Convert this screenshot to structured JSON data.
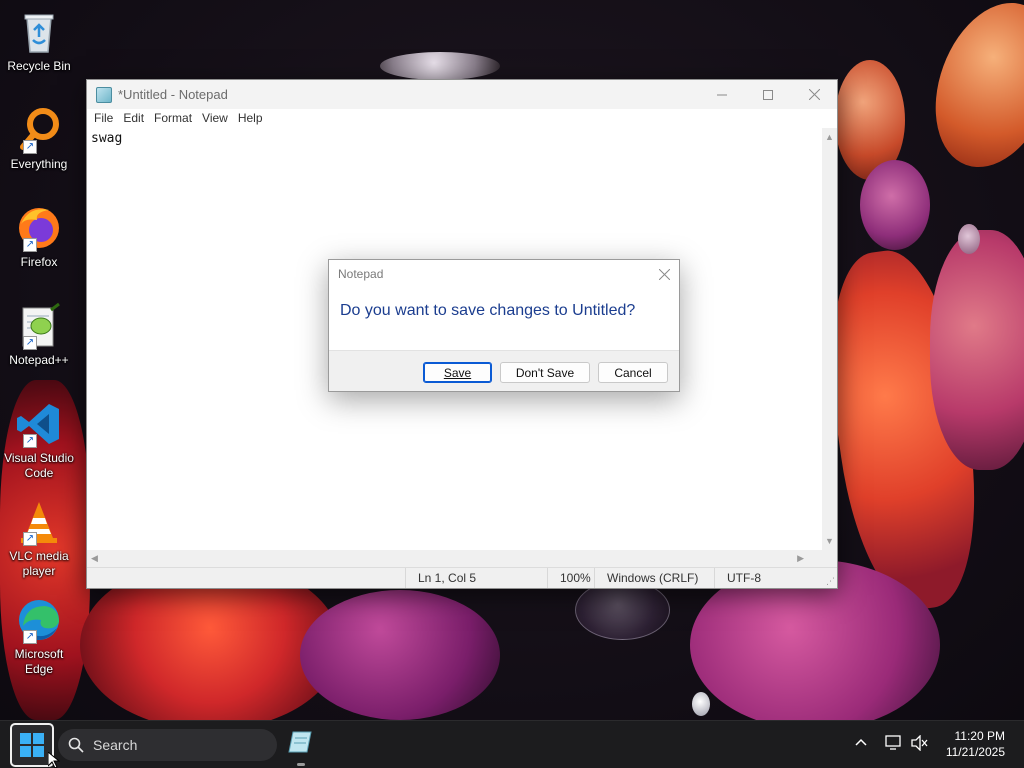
{
  "desktop": {
    "icons": [
      {
        "label": "Recycle Bin"
      },
      {
        "label": "Everything"
      },
      {
        "label": "Firefox"
      },
      {
        "label": "Notepad++"
      },
      {
        "label": "Visual Studio Code"
      },
      {
        "label": "VLC media player"
      },
      {
        "label": "Microsoft Edge"
      }
    ]
  },
  "notepad": {
    "title": "*Untitled - Notepad",
    "menu": [
      "File",
      "Edit",
      "Format",
      "View",
      "Help"
    ],
    "content": "swag",
    "status": {
      "position": "Ln 1, Col 5",
      "zoom": "100%",
      "line_endings": "Windows (CRLF)",
      "encoding": "UTF-8"
    }
  },
  "dialog": {
    "title": "Notepad",
    "message": "Do you want to save changes to Untitled?",
    "save": "Save",
    "dont_save": "Don't Save",
    "cancel": "Cancel"
  },
  "taskbar": {
    "search_label": "Search",
    "time": "11:20 PM",
    "date": "11/21/2025"
  },
  "colors": {
    "accent": "#0a5ad4",
    "dialog_message": "#1b3d8f",
    "taskbar": "#1c1c1e"
  }
}
